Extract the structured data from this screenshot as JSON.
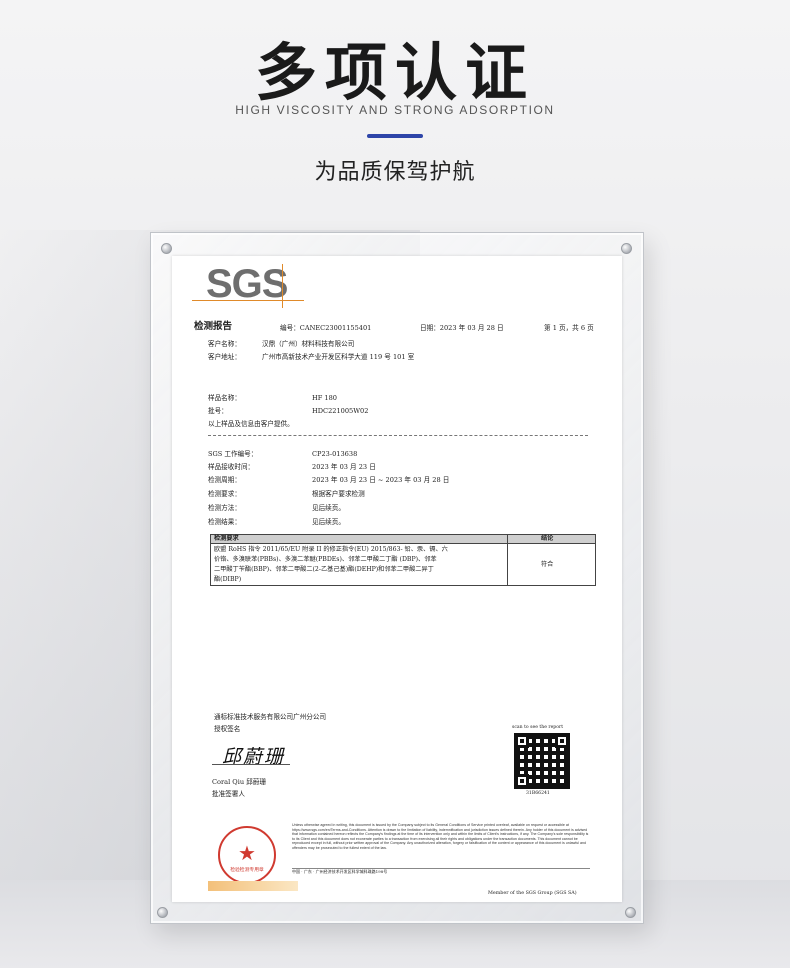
{
  "header": {
    "title": "多项认证",
    "subtitle_en": "HIGH VISCOSITY AND STRONG ADSORPTION",
    "subtitle_cn": "为品质保驾护航"
  },
  "colors": {
    "accent": "#2e45a8",
    "stamp_red": "#d03a30",
    "sgs_gray": "#6e6e6e",
    "sgs_orange": "#e08a2a"
  },
  "certificate": {
    "logo": "SGS",
    "report_label": "检测报告",
    "report_no": "编号：CANEC23001155401",
    "date": "日期：2023 年 03 月 28 日",
    "page": "第 1 页，共 6 页",
    "client_name_label": "客户名称：",
    "client_name": "汉鼎（广州）材料科技有限公司",
    "client_addr_label": "客户地址：",
    "client_addr": "广州市高新技术产业开发区科学大道 119 号 101 室",
    "sample_name_label": "样品名称：",
    "sample_name": "HF 180",
    "batch_label": "批号：",
    "batch": "HDC221005W02",
    "client_note": "以上样品及信息由客户提供。",
    "job_no_label": "SGS 工作编号：",
    "job_no": "CP23-013638",
    "received_label": "样品接收时间：",
    "received": "2023 年 03 月 23 日",
    "period_label": "检测周期：",
    "period": "2023 年 03 月 23 日 ~ 2023 年 03 月 28 日",
    "requirement_label": "检测要求：",
    "requirement": "根据客户要求检测",
    "method_label": "检测方法：",
    "method": "见后续页。",
    "result_label": "检测结果：",
    "result": "见后续页。",
    "table": {
      "col1": "检测要求",
      "col2": "结论",
      "row_lines": [
        "欧盟 RoHS 指令 2011/65/EU 附录 II 的修正指令(EU) 2015/863- 铅、汞、镉、六",
        "价铬、多溴联苯(PBBs)、多溴二苯醚(PBDEs)、邻苯二甲酸二丁酯 (DBP)、邻苯",
        "二甲酸丁苄酯(BBP)、邻苯二甲酸二(2-乙基己基)酯(DEHP)和邻苯二甲酸二异丁",
        "酯(DIBP)"
      ],
      "conclusion": "符合"
    },
    "signer_company": "通标标准技术服务有限公司广州分公司",
    "signer_auth": "授权签名",
    "signature": "邱蔚珊",
    "signer_name": "Coral Qiu 邱蔚珊",
    "signer_title": "批准签署人",
    "qr_caption": "scan to see the report",
    "qr_code": "31B66241",
    "stamp_text": "检验检测专用章",
    "fine_print": "Unless otherwise agreed in writing, this document is issued by the Company subject to its General Conditions of Service printed overleaf, available on request or accessible at https://www.sgs.com/en/Terms-and-Conditions. Attention is drawn to the limitation of liability, indemnification and jurisdiction issues defined therein. Any holder of this document is advised that information contained hereon reflects the Company's findings at the time of its intervention only and within the limits of Client's instructions, if any. The Company's sole responsibility is to its Client and this document does not exonerate parties to a transaction from exercising all their rights and obligations under the transaction documents. This document cannot be reproduced except in full, without prior written approval of the Company. Any unauthorized alteration, forgery or falsification of the content or appearance of this document is unlawful and offenders may be prosecuted to the fullest extent of the law.",
    "address_line": "中国 · 广东 · 广州经济技术开发区科学城科珠路198号",
    "member_text": "Member of the SGS Group (SGS SA)"
  }
}
